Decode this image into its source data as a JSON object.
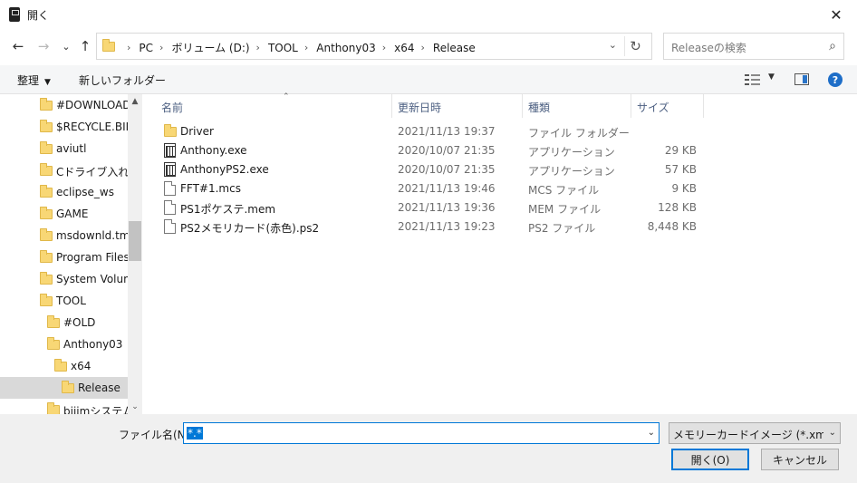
{
  "window": {
    "title": "開く",
    "close_glyph": "✕"
  },
  "nav": {
    "back": "←",
    "forward": "→",
    "recent": "⌄",
    "up": "↑"
  },
  "address": {
    "crumbs": [
      "PC",
      "ボリューム (D:)",
      "TOOL",
      "Anthony03",
      "x64",
      "Release"
    ],
    "dropdown": "⌄",
    "refresh": "↻"
  },
  "search": {
    "placeholder": "Releaseの検索",
    "icon": "⌕"
  },
  "toolbar": {
    "organize": "整理",
    "new_folder": "新しいフォルダー",
    "help": "?"
  },
  "navpane": {
    "items": [
      {
        "label": "#DOWNLOAD",
        "level": 1
      },
      {
        "label": "$RECYCLE.BIN",
        "level": 1
      },
      {
        "label": "aviutl",
        "level": 1
      },
      {
        "label": "Cドライブ入れ替え",
        "level": 1
      },
      {
        "label": "eclipse_ws",
        "level": 1
      },
      {
        "label": "GAME",
        "level": 1
      },
      {
        "label": "msdownld.tmp",
        "level": 1
      },
      {
        "label": "Program Files",
        "level": 1
      },
      {
        "label": "System Volume",
        "level": 1
      },
      {
        "label": "TOOL",
        "level": 1
      },
      {
        "label": "#OLD",
        "level": 2
      },
      {
        "label": "Anthony03",
        "level": 2
      },
      {
        "label": "x64",
        "level": 3
      },
      {
        "label": "Release",
        "level": 4,
        "selected": true
      },
      {
        "label": "bijimシステム",
        "level": 2
      }
    ],
    "scroll_up": "▲",
    "scroll_down": "⌄"
  },
  "columns": {
    "name": "名前",
    "date": "更新日時",
    "type": "種類",
    "size": "サイズ"
  },
  "files": [
    {
      "name": "Driver",
      "date": "2021/11/13 19:37",
      "type": "ファイル フォルダー",
      "size": "",
      "icon": "folder-icon"
    },
    {
      "name": "Anthony.exe",
      "date": "2020/10/07 21:35",
      "type": "アプリケーション",
      "size": "29 KB",
      "icon": "exe-icon"
    },
    {
      "name": "AnthonyPS2.exe",
      "date": "2020/10/07 21:35",
      "type": "アプリケーション",
      "size": "57 KB",
      "icon": "exe-icon"
    },
    {
      "name": "FFT#1.mcs",
      "date": "2021/11/13 19:46",
      "type": "MCS ファイル",
      "size": "9 KB",
      "icon": "file-icon"
    },
    {
      "name": "PS1ポケステ.mem",
      "date": "2021/11/13 19:36",
      "type": "MEM ファイル",
      "size": "128 KB",
      "icon": "file-icon"
    },
    {
      "name": "PS2メモリカード(赤色).ps2",
      "date": "2021/11/13 19:23",
      "type": "PS2 ファイル",
      "size": "8,448 KB",
      "icon": "file-icon"
    }
  ],
  "bottom": {
    "filename_label": "ファイル名(N):",
    "filename_value": "*.*",
    "filter": "メモリーカードイメージ (*.xmc,*.mem",
    "open": "開く(O)",
    "cancel": "キャンセル"
  },
  "colors": {
    "accent": "#0078d7",
    "folder": "#f8d775",
    "selected_row": "#d9d9d9"
  }
}
